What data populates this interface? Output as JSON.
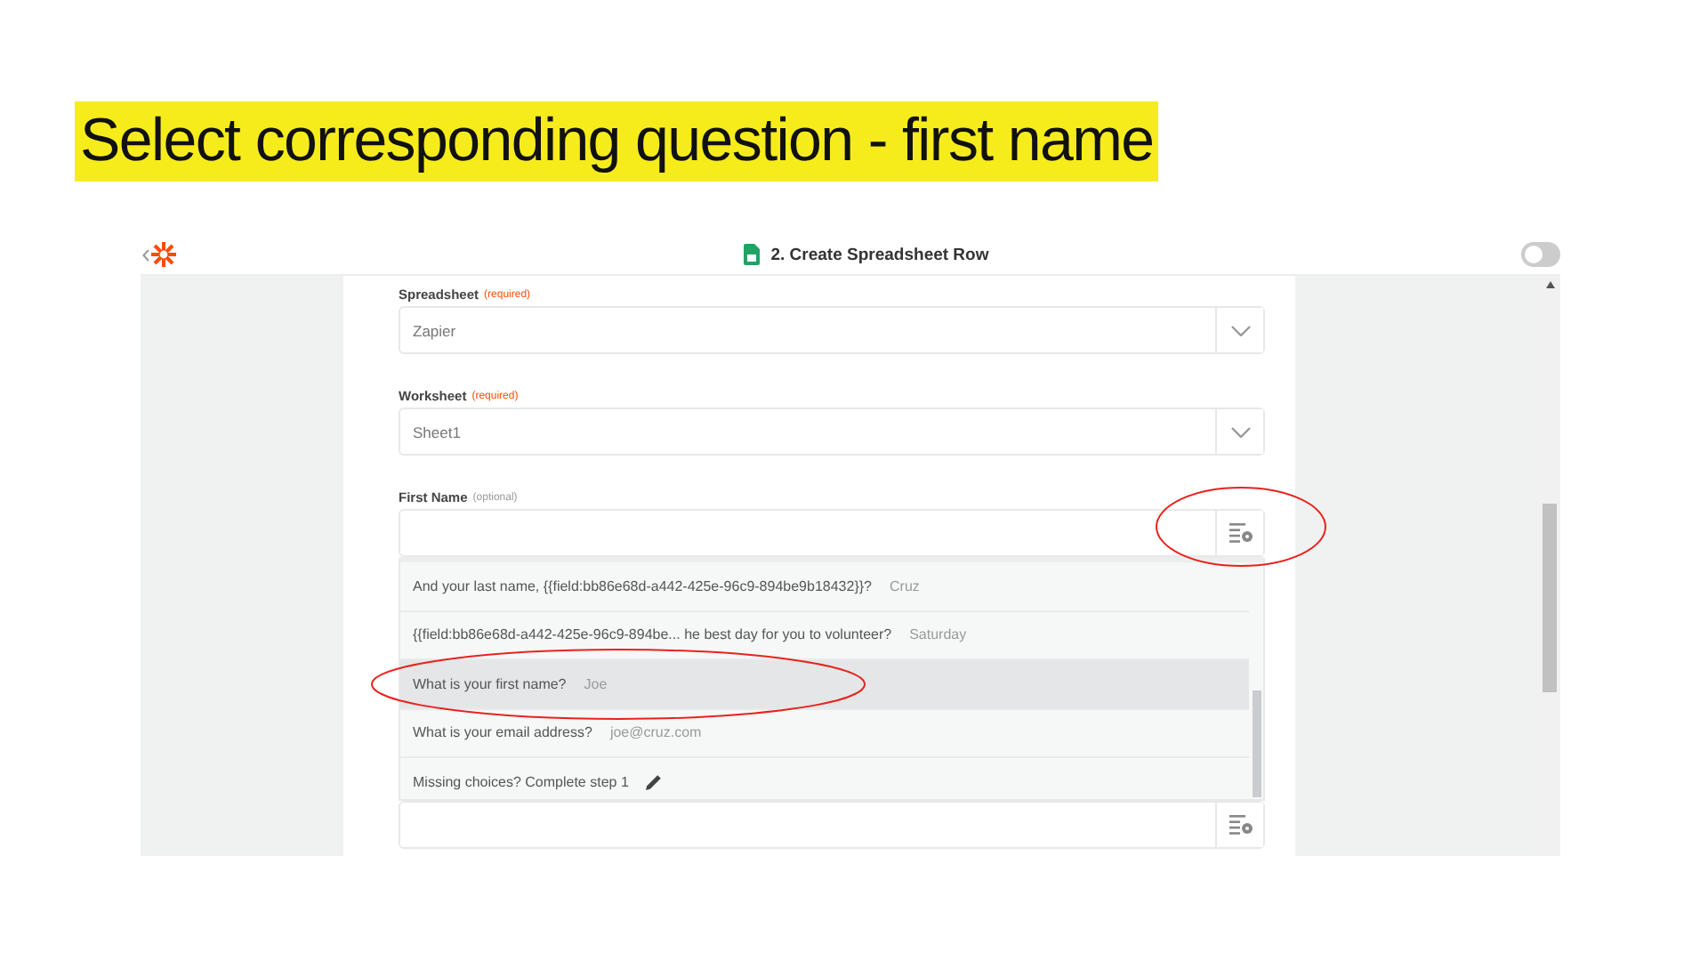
{
  "slide_title": "Select corresponding question - first name",
  "header": {
    "title": "2. Create Spreadsheet Row",
    "toggle_on": false
  },
  "fields": [
    {
      "kind": "select",
      "label": "Spreadsheet",
      "tag": "(required)",
      "value": "Zapier"
    },
    {
      "kind": "select",
      "label": "Worksheet",
      "tag": "(required)",
      "value": "Sheet1"
    },
    {
      "kind": "mapped",
      "label": "First Name",
      "tag": "(optional)",
      "button_circled": true,
      "options": [
        {
          "kind": "choice",
          "question": "And your last name, {{field:bb86e68d-a442-425e-96c9-894be9b18432}}?",
          "sample": "Cruz",
          "selected": false,
          "circled": false
        },
        {
          "kind": "choice",
          "question": "{{field:bb86e68d-a442-425e-96c9-894be... he best day for you to volunteer?",
          "sample": "Saturday",
          "selected": false,
          "circled": false
        },
        {
          "kind": "choice",
          "question": "What is your first name?",
          "sample": "Joe",
          "selected": true,
          "circled": true
        },
        {
          "kind": "choice",
          "question": "What is your email address?",
          "sample": "joe@cruz.com",
          "selected": false,
          "circled": false
        },
        {
          "kind": "missing",
          "question": "Missing choices? Complete step 1",
          "selected": false,
          "circled": false
        }
      ]
    },
    {
      "kind": "mapped"
    }
  ]
}
